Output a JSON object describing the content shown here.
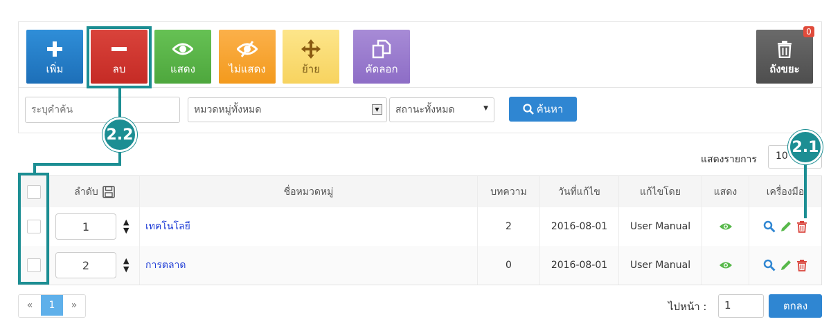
{
  "toolbar": {
    "add_label": "เพิ่ม",
    "delete_label": "ลบ",
    "show_label": "แสดง",
    "hide_label": "ไม่แสดง",
    "move_label": "ย้าย",
    "copy_label": "คัดลอก",
    "trash_label": "ถังขยะ",
    "trash_count": "0"
  },
  "filters": {
    "search_placeholder": "ระบุคำค้น",
    "category_value": "หมวดหมู่ทั้งหมด",
    "status_value": "สถานะทั้งหมด",
    "search_button": "ค้นหา"
  },
  "showcount": {
    "label": "แสดงรายการ",
    "value": "10"
  },
  "callouts": {
    "a": "2.2",
    "b": "2.1"
  },
  "table": {
    "headers": {
      "order": "ลำดับ",
      "name": "ชื่อหมวดหมู่",
      "articles": "บทความ",
      "modified": "วันที่แก้ไข",
      "modified_by": "แก้ไขโดย",
      "show": "แสดง",
      "tools": "เครื่องมือ"
    },
    "rows": [
      {
        "order": "1",
        "name": "เทคโนโลยี",
        "articles": "2",
        "modified": "2016-08-01",
        "modified_by": "User Manual"
      },
      {
        "order": "2",
        "name": "การตลาด",
        "articles": "0",
        "modified": "2016-08-01",
        "modified_by": "User Manual"
      }
    ]
  },
  "pagination": {
    "prev": "«",
    "current": "1",
    "next": "»"
  },
  "goto": {
    "label": "ไปหน้า :",
    "value": "1",
    "button": "ตกลง"
  },
  "colors": {
    "accent": "#1c8e93",
    "primary": "#2f86d2",
    "danger": "#d9433b",
    "success": "#57b84a"
  }
}
